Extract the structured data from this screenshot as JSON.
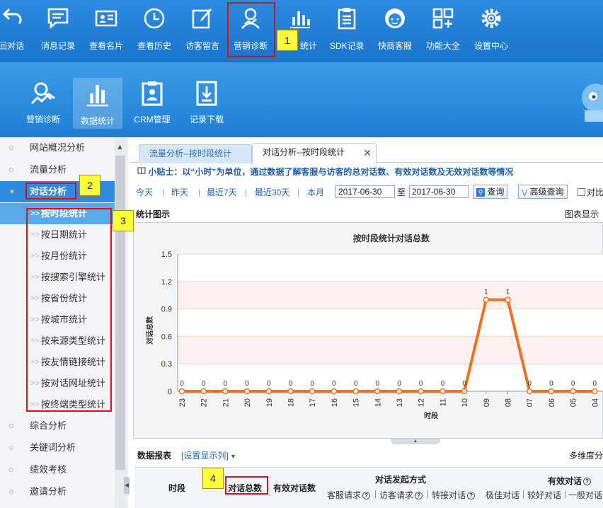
{
  "top_toolbar": {
    "items": [
      {
        "label": "回对话",
        "icon": "return-arrow-icon"
      },
      {
        "label": "消息记录",
        "icon": "message-icon"
      },
      {
        "label": "查看名片",
        "icon": "card-icon"
      },
      {
        "label": "查看历史",
        "icon": "clock-icon"
      },
      {
        "label": "访客留言",
        "icon": "edit-icon"
      },
      {
        "label": "营销诊断",
        "icon": "diagnosis-icon"
      },
      {
        "label": "统计",
        "icon": "bar-chart-icon"
      },
      {
        "label": "SDK记录",
        "icon": "clipboard-icon"
      },
      {
        "label": "快商客服",
        "icon": "support-icon"
      },
      {
        "label": "功能大全",
        "icon": "grid-icon"
      },
      {
        "label": "设置中心",
        "icon": "gear-icon"
      }
    ]
  },
  "sub_toolbar": {
    "items": [
      {
        "label": "营销诊断",
        "icon": "diagnosis-icon"
      },
      {
        "label": "数据统计",
        "icon": "bar-chart-icon"
      },
      {
        "label": "CRM管理",
        "icon": "crm-icon"
      },
      {
        "label": "记录下载",
        "icon": "download-icon"
      }
    ]
  },
  "sidebar": {
    "items": [
      {
        "label": "网站概况分析"
      },
      {
        "label": "流量分析"
      },
      {
        "label": "对话分析"
      },
      {
        "label": "综合分析"
      },
      {
        "label": "关键词分析"
      },
      {
        "label": "绩效考核"
      },
      {
        "label": "邀请分析"
      }
    ],
    "active_marker": "✶",
    "sub_items": [
      {
        "label": "按时段统计"
      },
      {
        "label": "按日期统计"
      },
      {
        "label": "按月份统计"
      },
      {
        "label": "按搜索引擎统计"
      },
      {
        "label": "按省份统计"
      },
      {
        "label": "按城市统计"
      },
      {
        "label": "按来源类型统计"
      },
      {
        "label": "按友情链接统计"
      },
      {
        "label": "按对话网址统计"
      },
      {
        "label": "按终端类型统计"
      }
    ]
  },
  "tabs": [
    {
      "label": "流量分析--按时段统计"
    },
    {
      "label": "对话分析--按时段统计",
      "close": "✕"
    }
  ],
  "tip": "小贴士：以“小时”为单位，通过数据了解客服与访客的总对话数、有效对话数及无效对话数等情况",
  "filters": {
    "today": "今天",
    "yesterday": "昨天",
    "last7": "最近7天",
    "last30": "最近30天",
    "this_month": "本月",
    "separator": "|",
    "start_date": "2017-06-30",
    "to": "至",
    "end_date": "2017-06-30",
    "query": "查询",
    "advanced": "高级查询",
    "compare": "对比"
  },
  "section": {
    "chart_title": "统计图示",
    "chart_display": "图表显示",
    "report_title": "数据报表",
    "set_columns": "[设置显示列]",
    "multi_dim": "多维度分"
  },
  "chart_data": {
    "type": "line",
    "title": "按时段统计对话总数",
    "xlabel": "时段",
    "ylabel": "对话总数",
    "ylim": [
      0,
      1.5
    ],
    "yticks": [
      "0",
      "0.3",
      "0.6",
      "0.9",
      "1.2",
      "1.5"
    ],
    "categories": [
      "23",
      "22",
      "21",
      "20",
      "19",
      "18",
      "17",
      "16",
      "15",
      "14",
      "13",
      "12",
      "11",
      "10",
      "09",
      "08",
      "07",
      "06",
      "05",
      "04"
    ],
    "series": [
      {
        "values": [
          0,
          0,
          0,
          0,
          0,
          0,
          0,
          0,
          0,
          0,
          0,
          0,
          0,
          0,
          1,
          1,
          0,
          0,
          0,
          0
        ]
      }
    ],
    "color": "#f07020"
  },
  "table_header": {
    "period": "时段",
    "total": "对话总数",
    "valid": "有效对话数",
    "initiation": "对话发起方式",
    "init_sub": [
      "客服请求",
      "访客请求",
      "转接对话"
    ],
    "valid_dialog": "有效对话",
    "valid_sub": [
      "极佳对话",
      "较好对话",
      "一般对话"
    ],
    "help": "?",
    "divider": "|"
  },
  "annotations": [
    "1",
    "2",
    "3",
    "4"
  ]
}
